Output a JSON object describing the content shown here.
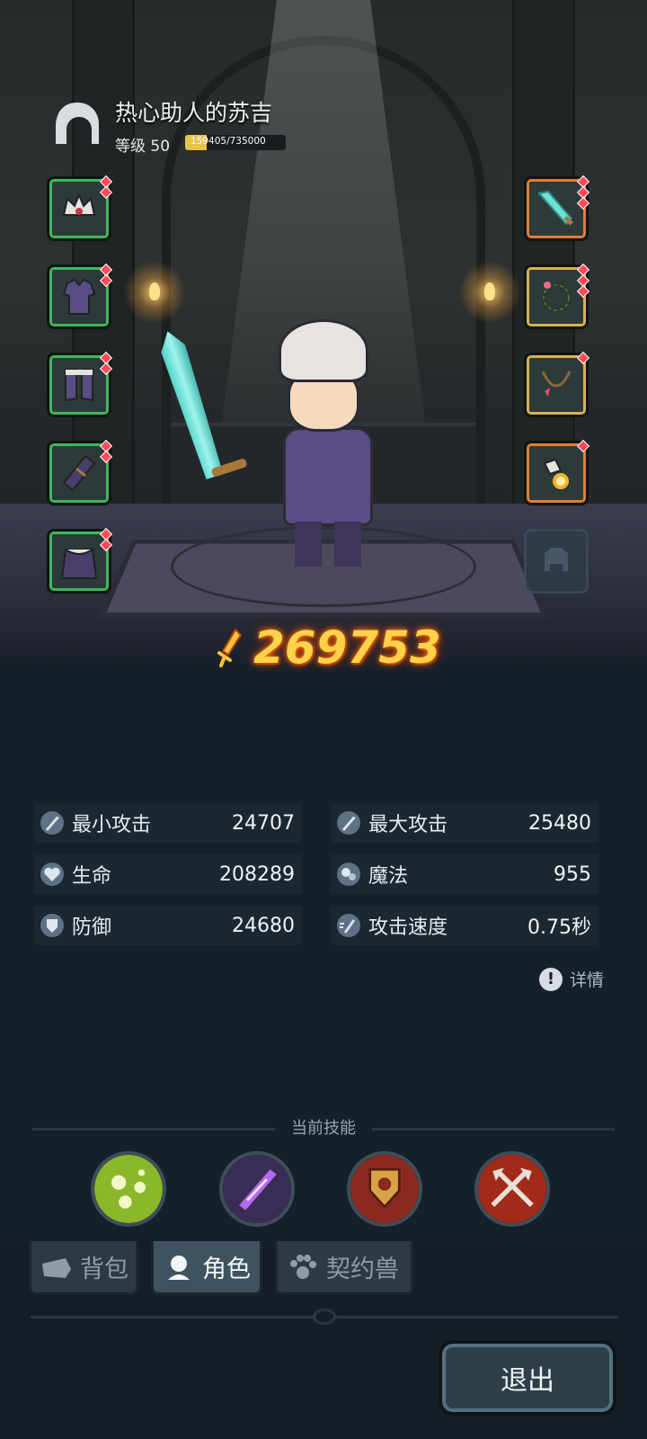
{
  "profile": {
    "name": "热心助人的苏吉",
    "level_label": "等级 50",
    "xp_text": "159405/735000",
    "xp_current": 159405,
    "xp_max": 735000
  },
  "power": {
    "value": "269753",
    "icon": "power-sword-icon",
    "color": "#ffd24a"
  },
  "equipment": {
    "left": [
      {
        "icon": "horned-helmet-icon",
        "rarity_color": "#3db85a"
      },
      {
        "icon": "purple-armor-icon",
        "rarity_color": "#3db85a"
      },
      {
        "icon": "purple-boots-icon",
        "rarity_color": "#3db85a"
      },
      {
        "icon": "bracer-icon",
        "rarity_color": "#3db85a"
      },
      {
        "icon": "fur-cape-icon",
        "rarity_color": "#3db85a"
      }
    ],
    "right": [
      {
        "icon": "crystal-sword-icon",
        "rarity_color": "#e07d37"
      },
      {
        "icon": "thorn-ring-icon",
        "rarity_color": "#d9b053"
      },
      {
        "icon": "gem-necklace-icon",
        "rarity_color": "#d9b053"
      },
      {
        "icon": "flame-talisman-icon",
        "rarity_color": "#e07d37"
      },
      {
        "icon": "empty-pet-slot-icon",
        "rarity_color": ""
      }
    ]
  },
  "stats": [
    {
      "label": "最小攻击",
      "value": "24707",
      "icon": "sword-icon"
    },
    {
      "label": "最大攻击",
      "value": "25480",
      "icon": "sword-icon"
    },
    {
      "label": "生命",
      "value": "208289",
      "icon": "heart-icon"
    },
    {
      "label": "魔法",
      "value": "955",
      "icon": "magic-orb-icon"
    },
    {
      "label": "防御",
      "value": "24680",
      "icon": "shield-icon"
    },
    {
      "label": "攻击速度",
      "value": "0.75秒",
      "icon": "speed-sword-icon"
    }
  ],
  "detail_label": "详情",
  "skills": {
    "title": "当前技能",
    "items": [
      {
        "icon": "green-spores-skill-icon"
      },
      {
        "icon": "purple-blade-skill-icon"
      },
      {
        "icon": "crest-shield-skill-icon"
      },
      {
        "icon": "crossed-axes-skill-icon"
      }
    ]
  },
  "tabs": [
    {
      "label": "背包",
      "icon": "bag-icon",
      "active": false
    },
    {
      "label": "角色",
      "icon": "character-icon",
      "active": true
    },
    {
      "label": "契约兽",
      "icon": "paw-icon",
      "active": false
    }
  ],
  "exit_label": "退出"
}
